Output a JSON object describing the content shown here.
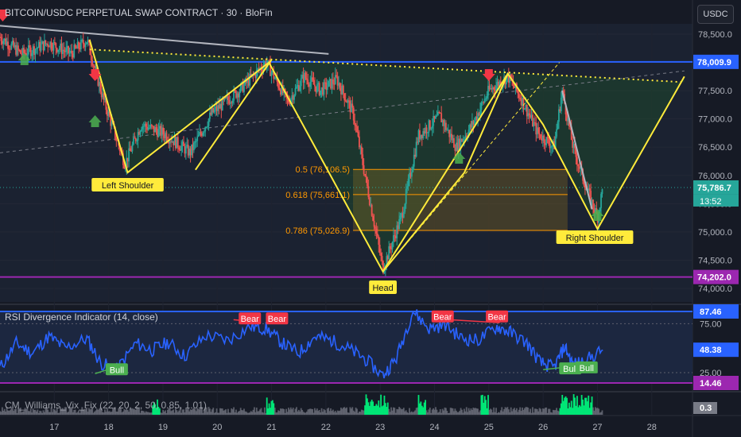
{
  "header": {
    "title": "BITCOIN/USDC PERPETUAL SWAP CONTRACT · 30 · BloFin",
    "currency": "USDC"
  },
  "chart_data": [
    {
      "type": "candlestick",
      "title": "BITCOIN/USDC PERPETUAL SWAP CONTRACT · 30 · BloFin",
      "x_ticks": [
        "17",
        "18",
        "19",
        "20",
        "21",
        "22",
        "23",
        "24",
        "25",
        "26",
        "27",
        "28"
      ],
      "y_ticks": [
        "78,500.0",
        "78,000.0",
        "77,500.0",
        "77,000.0",
        "76,500.0",
        "76,000.0",
        "75,500.0",
        "75,000.0",
        "74,500.0",
        "74,000.0"
      ],
      "ylim": [
        73,
        700,
        78,
        950
      ],
      "price_labels": {
        "resistance": "78,009.9",
        "last_price": "75,786.7",
        "countdown": "13:52",
        "support": "74,202.0"
      },
      "fibonacci": [
        {
          "label": "0.5 (76,106.5)",
          "value": 76106.5
        },
        {
          "label": "0.618 (75,661.1)",
          "value": 75661.1
        },
        {
          "label": "0.786 (75,026.9)",
          "value": 75026.9
        }
      ],
      "pattern_labels": {
        "left_shoulder": "Left Shoulder",
        "head": "Head",
        "right_shoulder": "Right Shoulder"
      },
      "head_and_shoulders_path": [
        {
          "x": 17.65,
          "y": 78400
        },
        {
          "x": 18.35,
          "y": 76050
        },
        {
          "x": 20.95,
          "y": 78000
        },
        {
          "x": 23.05,
          "y": 74300
        },
        {
          "x": 25.35,
          "y": 77800
        },
        {
          "x": 26.0,
          "y": 76900
        },
        {
          "x": 27.0,
          "y": 75050
        },
        {
          "x": 28.6,
          "y": 77750
        }
      ],
      "wedge_path": [
        {
          "x": 19.6,
          "y": 76100
        },
        {
          "x": 21.0,
          "y": 78050
        }
      ],
      "head_rise_path": [
        {
          "x": 23.05,
          "y": 74300
        },
        {
          "x": 24.55,
          "y": 76050
        },
        {
          "x": 25.35,
          "y": 77800
        }
      ],
      "trendline_gray": [
        {
          "x": 16.0,
          "y": 78650
        },
        {
          "x": 22.05,
          "y": 78150
        }
      ],
      "neckline_dotted": [
        {
          "x": 17.65,
          "y": 78230
        },
        {
          "x": 28.6,
          "y": 77650
        }
      ],
      "signals_down": [
        16.05,
        17.75,
        25.0
      ],
      "signals_up": [
        16.45,
        17.75,
        24.45,
        27.0
      ],
      "series": [
        {
          "name": "BTCUSDC",
          "close_path": [
            {
              "x": 16.0,
              "y": 78450
            },
            {
              "x": 16.4,
              "y": 78150
            },
            {
              "x": 16.9,
              "y": 78350
            },
            {
              "x": 17.3,
              "y": 78150
            },
            {
              "x": 17.6,
              "y": 78400
            },
            {
              "x": 17.9,
              "y": 77350
            },
            {
              "x": 18.3,
              "y": 76200
            },
            {
              "x": 18.6,
              "y": 76900
            },
            {
              "x": 19.0,
              "y": 76750
            },
            {
              "x": 19.5,
              "y": 76400
            },
            {
              "x": 19.9,
              "y": 77100
            },
            {
              "x": 20.4,
              "y": 77500
            },
            {
              "x": 20.9,
              "y": 78000
            },
            {
              "x": 21.3,
              "y": 77300
            },
            {
              "x": 21.6,
              "y": 77750
            },
            {
              "x": 21.9,
              "y": 77500
            },
            {
              "x": 22.2,
              "y": 77700
            },
            {
              "x": 22.5,
              "y": 77100
            },
            {
              "x": 22.8,
              "y": 75600
            },
            {
              "x": 23.05,
              "y": 74350
            },
            {
              "x": 23.4,
              "y": 75300
            },
            {
              "x": 23.7,
              "y": 76700
            },
            {
              "x": 24.1,
              "y": 77050
            },
            {
              "x": 24.4,
              "y": 76500
            },
            {
              "x": 24.7,
              "y": 76900
            },
            {
              "x": 25.0,
              "y": 77500
            },
            {
              "x": 25.35,
              "y": 77750
            },
            {
              "x": 25.6,
              "y": 77350
            },
            {
              "x": 25.9,
              "y": 76750
            },
            {
              "x": 26.2,
              "y": 76500
            },
            {
              "x": 26.35,
              "y": 77500
            },
            {
              "x": 26.55,
              "y": 76500
            },
            {
              "x": 26.75,
              "y": 75900
            },
            {
              "x": 27.0,
              "y": 75250
            },
            {
              "x": 27.1,
              "y": 75787
            }
          ]
        }
      ]
    },
    {
      "type": "line",
      "title": "RSI Divergence Indicator (14, close)",
      "y_ticks": [
        "75.00",
        "25.00"
      ],
      "ylim": [
        10,
        90
      ],
      "levels": {
        "upper": 87.46,
        "lower": 14.46,
        "upper_label": "87.46",
        "lower_label": "14.46"
      },
      "current_label": "48.38",
      "divergence_labels": [
        {
          "text": "Bull",
          "kind": "bull",
          "x": 18.15,
          "value": 28
        },
        {
          "text": "Bear",
          "kind": "bear",
          "x": 20.6,
          "value": 80
        },
        {
          "text": "Bear",
          "kind": "bear",
          "x": 21.1,
          "value": 80
        },
        {
          "text": "Bear",
          "kind": "bear",
          "x": 24.15,
          "value": 82
        },
        {
          "text": "Bear",
          "kind": "bear",
          "x": 25.15,
          "value": 82
        },
        {
          "text": "Bull",
          "kind": "bull",
          "x": 26.5,
          "value": 29
        },
        {
          "text": "Bull",
          "kind": "bull",
          "x": 26.8,
          "value": 30
        }
      ],
      "series": [
        {
          "name": "RSI",
          "points": [
            {
              "x": 16.0,
              "y": 30
            },
            {
              "x": 16.3,
              "y": 55
            },
            {
              "x": 16.6,
              "y": 45
            },
            {
              "x": 16.9,
              "y": 62
            },
            {
              "x": 17.2,
              "y": 50
            },
            {
              "x": 17.6,
              "y": 60
            },
            {
              "x": 17.85,
              "y": 35
            },
            {
              "x": 18.15,
              "y": 28
            },
            {
              "x": 18.5,
              "y": 55
            },
            {
              "x": 18.8,
              "y": 48
            },
            {
              "x": 19.1,
              "y": 56
            },
            {
              "x": 19.4,
              "y": 42
            },
            {
              "x": 19.8,
              "y": 63
            },
            {
              "x": 20.2,
              "y": 58
            },
            {
              "x": 20.6,
              "y": 72
            },
            {
              "x": 20.9,
              "y": 70
            },
            {
              "x": 21.2,
              "y": 55
            },
            {
              "x": 21.5,
              "y": 45
            },
            {
              "x": 21.8,
              "y": 62
            },
            {
              "x": 22.1,
              "y": 58
            },
            {
              "x": 22.4,
              "y": 50
            },
            {
              "x": 22.7,
              "y": 40
            },
            {
              "x": 23.05,
              "y": 22
            },
            {
              "x": 23.3,
              "y": 40
            },
            {
              "x": 23.6,
              "y": 88
            },
            {
              "x": 23.9,
              "y": 70
            },
            {
              "x": 24.2,
              "y": 74
            },
            {
              "x": 24.5,
              "y": 60
            },
            {
              "x": 24.8,
              "y": 58
            },
            {
              "x": 25.15,
              "y": 72
            },
            {
              "x": 25.4,
              "y": 66
            },
            {
              "x": 25.7,
              "y": 55
            },
            {
              "x": 25.95,
              "y": 35
            },
            {
              "x": 26.2,
              "y": 30
            },
            {
              "x": 26.4,
              "y": 52
            },
            {
              "x": 26.55,
              "y": 33
            },
            {
              "x": 26.8,
              "y": 38
            },
            {
              "x": 27.1,
              "y": 48
            }
          ]
        }
      ]
    },
    {
      "type": "bar",
      "title": "CM_Williams_Vix_Fix (22, 20, 2, 50, 0.85, 1.01)",
      "current_label": "0.3",
      "highlight_ranges": [
        [
          18.8,
          18.95
        ],
        [
          20.9,
          21.05
        ],
        [
          22.7,
          23.15
        ],
        [
          23.7,
          23.85
        ],
        [
          24.85,
          25.0
        ],
        [
          26.3,
          26.9
        ]
      ]
    }
  ],
  "colors": {
    "background": "#161a25",
    "candle_up": "#26a69a",
    "candle_down": "#ef5350",
    "resistance_line": "#2962ff",
    "support_line": "#9c27b0",
    "pattern_line": "#ffeb3b",
    "fib_line": "#ff9800",
    "rsi_line": "#2962ff",
    "bear_label": "#f23645",
    "bull_label": "#4caf50",
    "vix_highlight": "#00e676",
    "vix_base": "#787b86"
  }
}
